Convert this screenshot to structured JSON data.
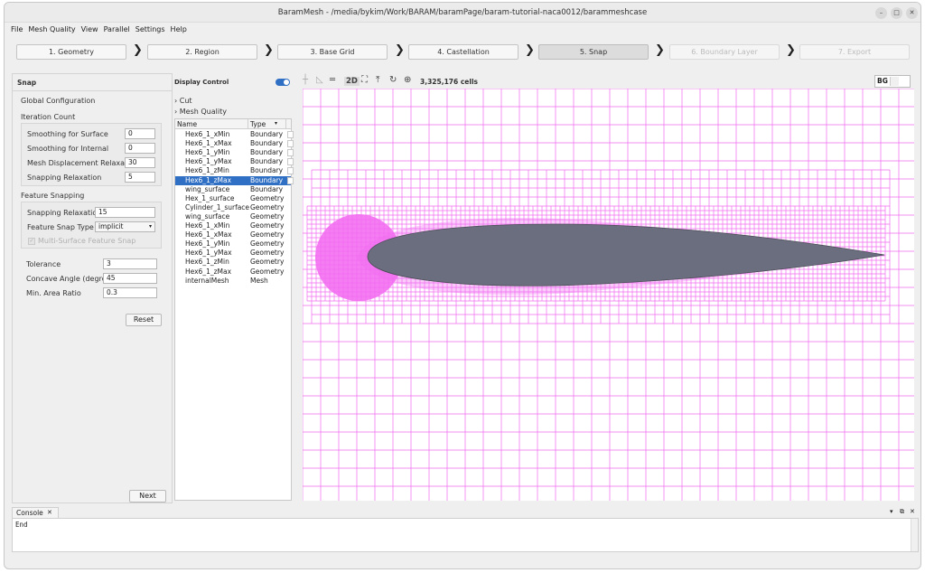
{
  "window": {
    "title": "BaramMesh - /media/bykim/Work/BARAM/baramPage/baram-tutorial-naca0012/barammeshcase"
  },
  "menu": [
    "File",
    "Mesh Quality",
    "View",
    "Parallel",
    "Settings",
    "Help"
  ],
  "steps": [
    {
      "label": "1. Geometry",
      "state": "normal"
    },
    {
      "label": "2. Region",
      "state": "normal"
    },
    {
      "label": "3. Base Grid",
      "state": "normal"
    },
    {
      "label": "4. Castellation",
      "state": "normal"
    },
    {
      "label": "5. Snap",
      "state": "active"
    },
    {
      "label": "6. Boundary Layer",
      "state": "disabled"
    },
    {
      "label": "7. Export",
      "state": "disabled"
    }
  ],
  "snap": {
    "title": "Snap",
    "global_config": "Global Configuration",
    "iteration_count": "Iteration Count",
    "smoothing_surface_label": "Smoothing for Surface",
    "smoothing_surface_value": "0",
    "smoothing_internal_label": "Smoothing for Internal",
    "smoothing_internal_value": "0",
    "mesh_disp_label": "Mesh Displacement Relaxation",
    "mesh_disp_value": "30",
    "snap_relax_label": "Snapping Relaxation",
    "snap_relax_value": "5",
    "feature_snapping": "Feature Snapping",
    "feature_relax_label": "Snapping Relaxation",
    "feature_relax_value": "15",
    "feature_type_label": "Feature Snap Type",
    "feature_type_value": "implicit",
    "multi_surface_label": "Multi-Surface Feature Snap",
    "tolerance_label": "Tolerance",
    "tolerance_value": "3",
    "concave_label": "Concave Angle (degree)",
    "concave_value": "45",
    "min_area_label": "Min. Area Ratio",
    "min_area_value": "0.3",
    "reset_label": "Reset",
    "next_label": "Next"
  },
  "display": {
    "title": "Display Control",
    "cut_label": "Cut",
    "mesh_quality_label": "Mesh Quality",
    "col_name": "Name",
    "col_type": "Type",
    "rows": [
      {
        "name": "Hex6_1_xMin",
        "type": "Boundary"
      },
      {
        "name": "Hex6_1_xMax",
        "type": "Boundary"
      },
      {
        "name": "Hex6_1_yMin",
        "type": "Boundary"
      },
      {
        "name": "Hex6_1_yMax",
        "type": "Boundary"
      },
      {
        "name": "Hex6_1_zMin",
        "type": "Boundary"
      },
      {
        "name": "Hex6_1_zMax",
        "type": "Boundary"
      },
      {
        "name": "wing_surface",
        "type": "Boundary"
      },
      {
        "name": "Hex_1_surface",
        "type": "Geometry"
      },
      {
        "name": "Cylinder_1_surface",
        "type": "Geometry"
      },
      {
        "name": "wing_surface",
        "type": "Geometry"
      },
      {
        "name": "Hex6_1_xMin",
        "type": "Geometry"
      },
      {
        "name": "Hex6_1_xMax",
        "type": "Geometry"
      },
      {
        "name": "Hex6_1_yMin",
        "type": "Geometry"
      },
      {
        "name": "Hex6_1_yMax",
        "type": "Geometry"
      },
      {
        "name": "Hex6_1_zMin",
        "type": "Geometry"
      },
      {
        "name": "Hex6_1_zMax",
        "type": "Geometry"
      },
      {
        "name": "internalMesh",
        "type": "Mesh"
      }
    ]
  },
  "view": {
    "mode_2d": "2D",
    "cells": "3,325,176 cells",
    "bg_label": "BG"
  },
  "console": {
    "tab_label": "Console",
    "text": "End"
  },
  "colors": {
    "mesh": "#f26bf0",
    "airfoil": "#6b6e7e",
    "selection": "#2f6fc4"
  }
}
